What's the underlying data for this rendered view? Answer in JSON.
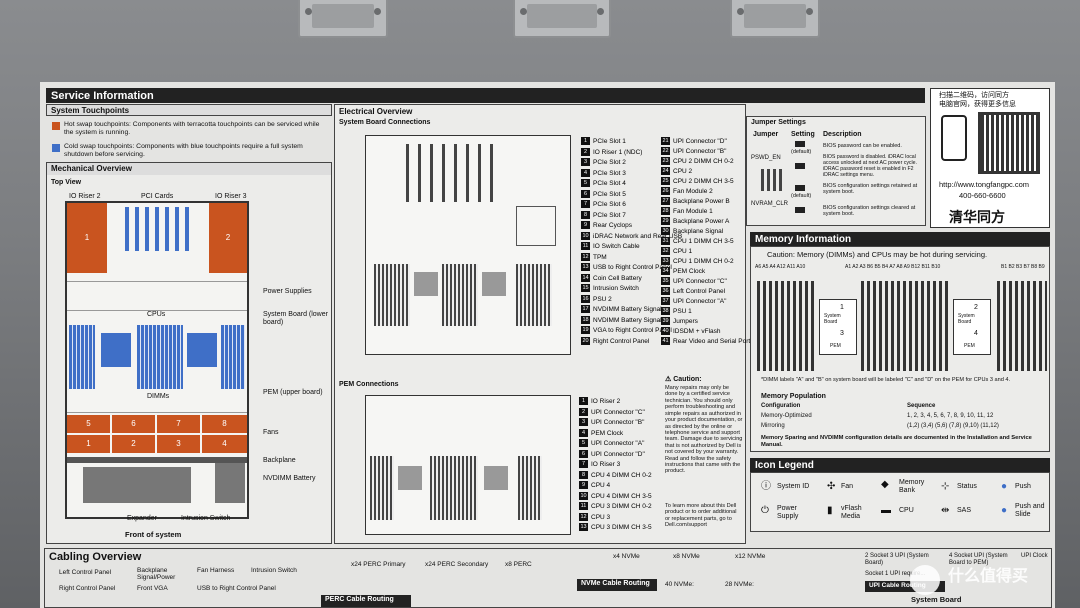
{
  "header": {
    "title": "Service Information",
    "qr_line1": "扫描二维码，访问同方",
    "qr_line2": "电脑官网，获得更多信息",
    "url": "http://www.tongfangpc.com",
    "phone": "400-660-6600",
    "brand": "清华同方"
  },
  "touchpoints": {
    "title": "System Touchpoints",
    "hot": "Hot swap touchpoints: Components with terracotta touchpoints can be serviced while the system is running.",
    "cold": "Cold swap touchpoints: Components with blue touchpoints require a full system shutdown before servicing.",
    "hot_color": "#c9541f",
    "cold_color": "#3f6fc7"
  },
  "mechanical": {
    "title": "Mechanical Overview",
    "top_view": "Top View",
    "io_riser2": "IO Riser 2",
    "pci_cards": "PCI Cards",
    "io_riser3": "IO Riser 3",
    "num1": "1",
    "num2": "2",
    "cpus": "CPUs",
    "dimms": "DIMMs",
    "power_supplies": "Power Supplies",
    "system_board": "System Board (lower board)",
    "pem": "PEM (upper board)",
    "fans": "Fans",
    "backplane": "Backplane",
    "nvdimm": "NVDIMM Battery",
    "expander": "Expander",
    "intrusion": "Intrusion Switch",
    "front": "Front of system",
    "fan_top": [
      "5",
      "6",
      "7",
      "8"
    ],
    "fan_bottom": [
      "1",
      "2",
      "3",
      "4"
    ]
  },
  "electrical": {
    "title": "Electrical Overview",
    "sb_title": "System Board Connections",
    "pem_title": "PEM Connections",
    "sb_col1": [
      "PCIe Slot 1",
      "IO Riser 1 (NDC)",
      "PCIe Slot 2",
      "PCIe Slot 3",
      "PCIe Slot 4",
      "PCIe Slot 5",
      "PCIe Slot 6",
      "PCIe Slot 7",
      "Rear Cyclops",
      "iDRAC Network and Rear USB",
      "IO Switch Cable",
      "TPM",
      "USB to Right Control Panel",
      "Coin Cell Battery",
      "Intrusion Switch",
      "PSU 2",
      "NVDIMM Battery Signal",
      "NVDIMM Battery Signal",
      "VGA to Right Control Panel",
      "Right Control Panel"
    ],
    "sb_col1_nums": [
      "1",
      "2",
      "3",
      "4",
      "5",
      "6",
      "7",
      "8",
      "9",
      "10",
      "11",
      "12",
      "13",
      "14",
      "15",
      "16",
      "17",
      "18",
      "19",
      "20"
    ],
    "sb_col2": [
      "UPI Connector \"D\"",
      "UPI Connector \"B\"",
      "CPU 2 DIMM CH 0-2",
      "CPU 2",
      "CPU 2 DIMM CH 3-5",
      "Fan Module 2",
      "Backplane Power B",
      "Fan Module 1",
      "Backplane Power A",
      "Backplane Signal",
      "CPU 1 DIMM CH 3-5",
      "CPU 1",
      "CPU 1 DIMM CH 0-2",
      "PEM Clock",
      "UPI Connector \"C\"",
      "Left Control Panel",
      "UPI Connector \"A\"",
      "PSU 1",
      "Jumpers",
      "IDSDM + vFlash",
      "Rear Video and Serial Port"
    ],
    "sb_col2_nums": [
      "21",
      "22",
      "23",
      "24",
      "25",
      "26",
      "27",
      "28",
      "29",
      "30",
      "31",
      "32",
      "33",
      "34",
      "35",
      "36",
      "37",
      "38",
      "39",
      "40",
      "41"
    ],
    "pem_list": [
      "IO Riser 2",
      "UPI Connector \"C\"",
      "UPI Connector \"B\"",
      "PEM Clock",
      "UPI Connector \"A\"",
      "UPI Connector \"D\"",
      "IO Riser 3",
      "CPU 4 DIMM CH 0-2",
      "CPU 4",
      "CPU 4 DIMM CH 3-5",
      "CPU 3 DIMM CH 0-2",
      "CPU 3",
      "CPU 3 DIMM CH 3-5"
    ],
    "pem_nums": [
      "1",
      "2",
      "3",
      "4",
      "5",
      "6",
      "7",
      "8",
      "9",
      "10",
      "11",
      "12",
      "13"
    ],
    "caution_title": "Caution:",
    "caution_text": "Many repairs may only be done by a certified service technician. You should only perform troubleshooting and simple repairs as authorized in your product documentation, or as directed by the online or telephone service and support team. Damage due to servicing that is not authorized by Dell is not covered by your warranty. Read and follow the safety instructions that came with the product.",
    "learn_more": "To learn more about this Dell product or to order additional or replacement parts, go to Dell.com/support"
  },
  "jumpers": {
    "title": "Jumper Settings",
    "headers": [
      "Jumper",
      "Setting",
      "Description"
    ],
    "pswd": "PSWD_EN",
    "nvram": "NVRAM_CLR",
    "default": "(default)",
    "rows": [
      "BIOS password can be enabled.",
      "BIOS password is disabled. iDRAC local access unlocked at next AC power cycle. iDRAC password reset is enabled in F2 iDRAC settings menu.",
      "BIOS configuration settings retained at system boot.",
      "BIOS configuration settings cleared at system boot."
    ]
  },
  "memory": {
    "title": "Memory Information",
    "caution": "Caution: Memory (DIMMs) and CPUs may be hot during servicing.",
    "cpu1": "1",
    "cpu3": "3",
    "cpu2": "2",
    "cpu4": "4",
    "sysboard": "System Board",
    "pem": "PEM",
    "footnote": "*DIMM labels \"A\" and \"B\" on system board will be labeled \"C\" and \"D\" on the PEM for CPUs 3 and 4.",
    "population_title": "Memory Population",
    "config_label": "Configuration",
    "sequence_label": "Sequence",
    "opt_label": "Memory-Optimized",
    "opt_seq": "1, 2, 3, 4, 5, 6, 7, 8, 9, 10, 11, 12",
    "mirror_label": "Mirroring",
    "mirror_seq": "(1,2) (3,4) (5,6) (7,8) (9,10) (11,12)",
    "doc_note": "Memory Sparing and NVDIMM configuration details are documented in the Installation and Service Manual.",
    "labels_left": "A6 A5 A4  A12 A11 A10",
    "labels_mid": "A1 A2 A3 B6 B5 B4  A7 A8 A9 B12 B11 B10",
    "labels_right": "B1 B2 B3  B7 B8 B9"
  },
  "icons": {
    "title": "Icon Legend",
    "items": [
      "System ID",
      "Fan",
      "Memory Bank",
      "Status",
      "Push",
      "Power Supply",
      "vFlash Media",
      "CPU",
      "SAS",
      "Push and Slide"
    ]
  },
  "cabling": {
    "title": "Cabling Overview",
    "legend": [
      "Left Control Panel",
      "Backplane Signal/Power",
      "Fan Harness",
      "Intrusion Switch",
      "Right Control Panel",
      "Front VGA",
      "USB to Right Control Panel"
    ],
    "perc": [
      "x24 PERC Primary",
      "x24 PERC Secondary",
      "x8 PERC"
    ],
    "perc_routing": "PERC Cable Routing",
    "nvme": [
      "x4 NVMe",
      "x8 NVMe",
      "x12 NVMe"
    ],
    "nvme_routing": "NVMe Cable Routing",
    "nvme40": "40 NVMe:",
    "nvme28": "28 NVMe:",
    "upi": [
      "2 Socket 3 UPI (System Board)",
      "4 Socket UPI (System Board to PEM)",
      "UPI Clock"
    ],
    "upi_note": "Socket 1 UPI require...",
    "upi_routing": "UPI Cable Routing",
    "system_board": "System Board"
  },
  "watermark": "什么值得买"
}
